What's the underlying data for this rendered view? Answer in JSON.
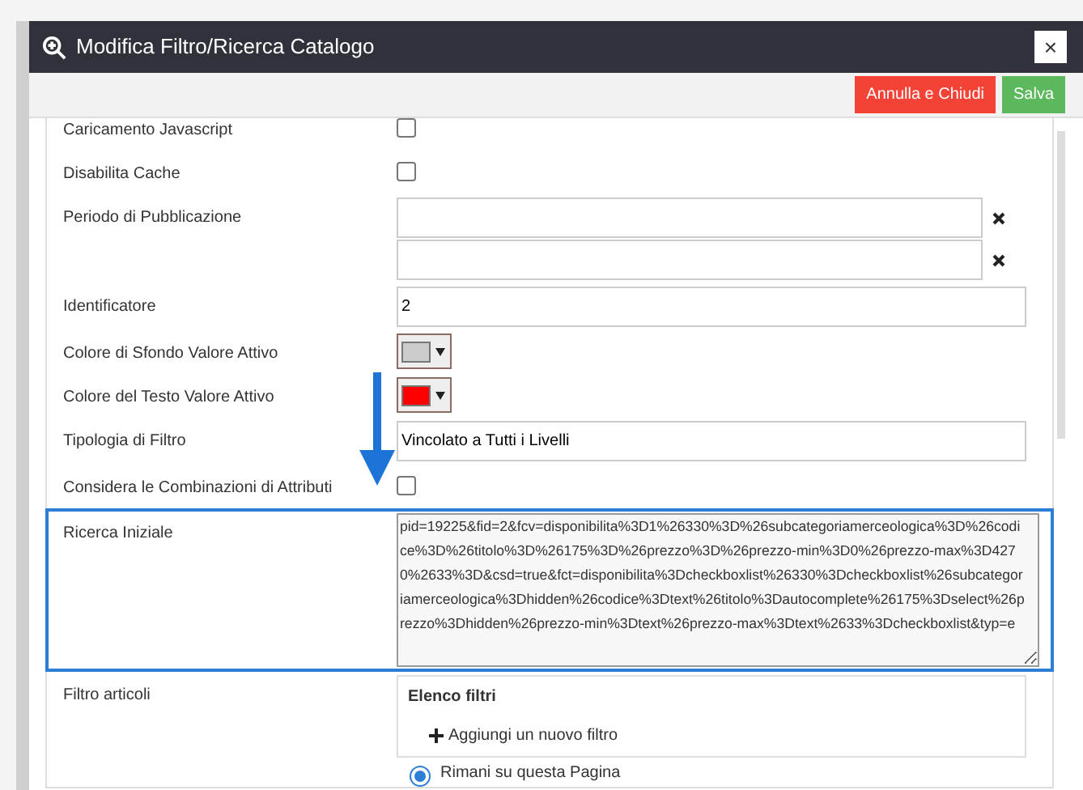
{
  "dialog": {
    "title": "Modifica Filtro/Ricerca Catalogo",
    "close_glyph": "×"
  },
  "buttons": [
    {
      "label": "Annulla e Chiudi",
      "kind": "danger"
    },
    {
      "label": "Salva",
      "kind": "success"
    }
  ],
  "fields": [
    {
      "label": "Caricamento Javascript",
      "kind": "checkbox",
      "checked": false
    },
    {
      "label": "Disabilita Cache",
      "kind": "checkbox",
      "checked": false
    },
    {
      "label": "Periodo di Pubblicazione",
      "kind": "daterange"
    },
    {
      "label": "Identificatore",
      "kind": "text",
      "value": "2"
    },
    {
      "label": "Colore di Sfondo Valore Attivo",
      "kind": "color",
      "color": "#cccccc"
    },
    {
      "label": "Colore del Testo Valore Attivo",
      "kind": "color",
      "color": "#ff0000"
    },
    {
      "label": "Tipologia di Filtro",
      "kind": "wide",
      "value": "Vincolato a Tutti i Livelli"
    },
    {
      "label": "Considera le Combinazioni di Attributi",
      "kind": "checkbox",
      "checked": false
    },
    {
      "label": "Ricerca Iniziale",
      "kind": "textarea",
      "highlighted": true,
      "value": "pid=19225&fid=2&fcv=disponibilita%3D1%26330%3D%26subcategoriamerceologica%3D%26codice%3D%26titolo%3D%26175%3D%26prezzo%3D%26prezzo-min%3D0%26prezzo-max%3D4270%2633%3D&csd=true&fct=disponibilita%3Dcheckboxlist%26330%3Dcheckboxlist%26subcategoriamerceologica%3Dhidden%26codice%3Dtext%26titolo%3Dautocomplete%26175%3Dselect%26prezzo%3Dhidden%26prezzo-min%3Dtext%26prezzo-max%3Dtext%2633%3Dcheckboxlist&typ=e"
    },
    {
      "label": "Filtro articoli",
      "kind": "filters",
      "heading": "Elenco filtri",
      "add_label": "Aggiungi un nuovo filtro"
    }
  ],
  "redirect": {
    "label": "Rimani su questa Pagina",
    "selected": true
  }
}
